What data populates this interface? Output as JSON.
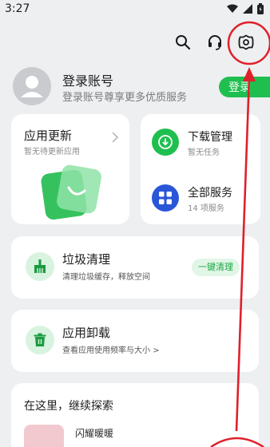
{
  "status_bar": {
    "time": "3:27"
  },
  "topbar": {
    "icons": [
      "search-icon",
      "headset-icon",
      "settings-icon"
    ]
  },
  "account": {
    "title": "登录账号",
    "subtitle": "登录账号尊享更多优质服务",
    "login_label": "登录"
  },
  "app_update": {
    "title": "应用更新",
    "subtitle": "暂无待更新应用"
  },
  "services": [
    {
      "title": "下载管理",
      "subtitle": "暂无任务",
      "icon": "download-icon"
    },
    {
      "title": "全部服务",
      "subtitle": "14 项服务",
      "icon": "grid-icon"
    }
  ],
  "cleanup": {
    "title": "垃圾清理",
    "subtitle": "清理垃圾缓存，释放空间",
    "button": "一键清理"
  },
  "uninstall": {
    "title": "应用卸载",
    "subtitle": "查看应用使用频率与大小",
    "chevron": ">"
  },
  "explore": {
    "title": "在这里，继续探索",
    "app_name": "闪耀暖暖"
  },
  "colors": {
    "accent": "#1fbf4f",
    "blue": "#2a56d8",
    "annotation": "#e0202a",
    "background": "#eeeff1"
  }
}
